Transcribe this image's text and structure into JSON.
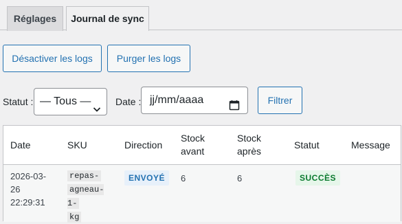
{
  "tabs": [
    {
      "label": "Réglages"
    },
    {
      "label": "Journal de sync"
    }
  ],
  "actions": {
    "disable_logs": "Désactiver les logs",
    "purge_logs": "Purger les logs"
  },
  "filters": {
    "status_label": "Statut :",
    "status_selected": "— Tous —",
    "date_label": "Date :",
    "date_placeholder": "jj/mm/aaaa",
    "filter_button": "Filtrer"
  },
  "table": {
    "columns": [
      "Date",
      "SKU",
      "Direction",
      "Stock avant",
      "Stock après",
      "Statut",
      "Message"
    ],
    "rows": [
      {
        "date_day": "2026-03-",
        "date_day2": "26",
        "time": "22:29:31",
        "sku": "repas-agneau-1-kg",
        "sku_lines": [
          "repas-",
          "agneau-1-",
          "kg"
        ],
        "direction": "ENVOYÉ",
        "stock_before": "6",
        "stock_after": "6",
        "status": "SUCCÈS",
        "message": ""
      }
    ]
  },
  "colors": {
    "accent": "#2271b1",
    "success_bg": "#e6f6ea",
    "success_text": "#0a7a2e",
    "direction_bg": "#e7f0fa"
  }
}
